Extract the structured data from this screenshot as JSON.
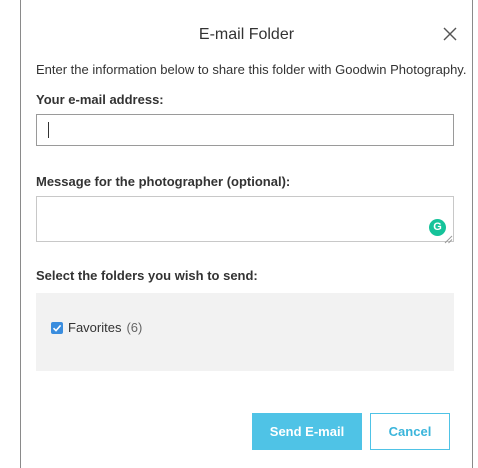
{
  "dialog": {
    "title": "E-mail Folder",
    "intro": "Enter the information below to share this folder with Goodwin Photography.",
    "close_icon": "close-icon"
  },
  "email": {
    "label": "Your e-mail address:",
    "value": ""
  },
  "message": {
    "label": "Message for the photographer (optional):",
    "value": "",
    "grammarly_badge": "G"
  },
  "folders": {
    "label": "Select the folders you wish to send:",
    "items": [
      {
        "name": "Favorites",
        "count": "(6)",
        "checked": true
      }
    ]
  },
  "buttons": {
    "send": "Send E-mail",
    "cancel": "Cancel"
  },
  "colors": {
    "accent": "#4fc3e6",
    "checkbox": "#3a8dde",
    "grammarly": "#15c39a"
  }
}
